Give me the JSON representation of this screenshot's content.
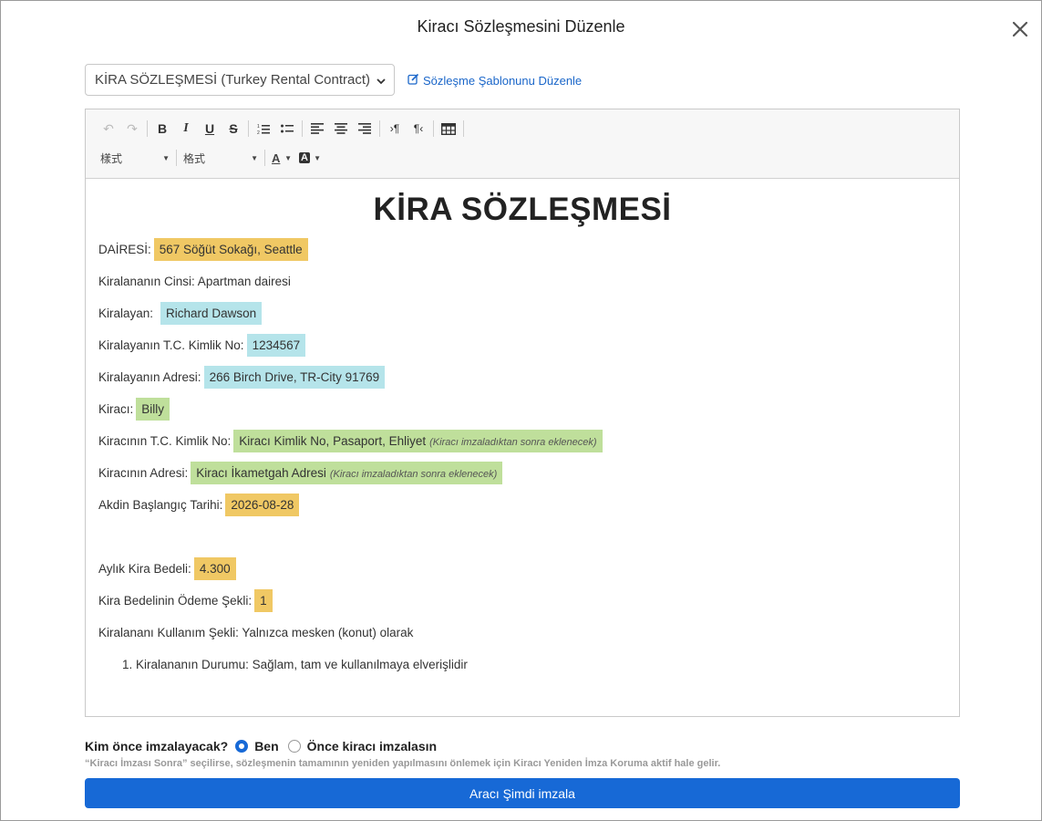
{
  "modal": {
    "title": "Kiracı Sözleşmesini Düzenle"
  },
  "template_select": {
    "value": "KİRA SÖZLEŞMESİ (Turkey Rental Contract)"
  },
  "template_link": {
    "label": "Sözleşme Şablonunu Düzenle"
  },
  "toolbar": {
    "style_combo": "樣式",
    "format_combo": "格式"
  },
  "document": {
    "heading": "KİRA SÖZLEŞMESİ",
    "fields": [
      {
        "label": "DAİRESİ:",
        "value": "567 Söğüt Sokağı, Seattle",
        "note": ""
      },
      {
        "label": "Kiralananın Cinsi: Apartman dairesi"
      },
      {
        "label": "Kiralayan:",
        "value": "Richard Dawson"
      },
      {
        "label": "Kiralayanın T.C. Kimlik No:",
        "value": "1234567"
      },
      {
        "label": "Kiralayanın Adresi:",
        "value": "266 Birch Drive, TR-City 91769"
      },
      {
        "label": "Kiracı:",
        "value": "Billy"
      },
      {
        "label": "Kiracının T.C. Kimlik No:",
        "value": "Kiracı Kimlik No, Pasaport, Ehliyet",
        "note": "(Kiracı imzaladıktan sonra eklenecek)"
      },
      {
        "label": "Kiracının Adresi:",
        "value": "Kiracı İkametgah Adresi",
        "note": "(Kiracı imzaladıktan sonra eklenecek)"
      },
      {
        "label": "Akdin Başlangıç Tarihi:",
        "value": "2026-08-28"
      },
      {
        "label": "Aylık Kira Bedeli:",
        "value": "4.300"
      },
      {
        "label": "Kira Bedelinin Ödeme Şekli:",
        "value": "1"
      },
      {
        "label": "Kiralananı Kullanım Şekli: Yalnızca mesken (konut) olarak"
      }
    ],
    "list_item": "1. Kiralananın Durumu: Sağlam, tam ve kullanılmaya elverişlidir"
  },
  "signing": {
    "question": "Kim önce imzalayacak?",
    "option_me": "Ben",
    "option_tenant": "Önce kiracı imzalasın",
    "hint": "“Kiracı İmzası Sonra” seçilirse, sözleşmenin tamamının yeniden yapılmasını önlemek için Kiracı Yeniden İmza Koruma aktif hale gelir.",
    "button": "Aracı Şimdi imzala"
  },
  "colors": {
    "primary": "#1769d6",
    "highlight_orange": "#f0c864",
    "highlight_blue": "#b5e4ea",
    "highlight_green": "#bfdf9b",
    "link": "#1a66c9"
  }
}
